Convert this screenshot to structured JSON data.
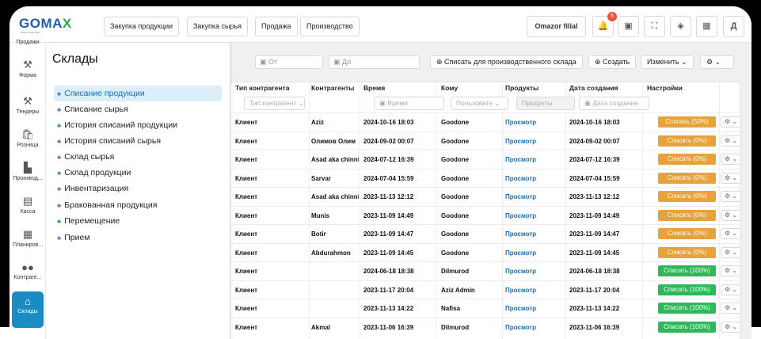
{
  "logo": {
    "text_main": "GOMA",
    "text_x": "X",
    "tagline": "make in high place"
  },
  "nav": [
    "Закупка продукции",
    "Закупка сырья",
    "Продажа",
    "Производство"
  ],
  "filial": "Omazor filial",
  "notifications": {
    "count": "5"
  },
  "user_initial": "Д",
  "sidebar": [
    {
      "label": "Продажи",
      "icon": "sales-icon"
    },
    {
      "label": "Форма",
      "icon": "hammer-icon"
    },
    {
      "label": "Тендеры",
      "icon": "hammer-icon"
    },
    {
      "label": "Розница",
      "icon": "bag-icon"
    },
    {
      "label": "Производ...",
      "icon": "factory-icon"
    },
    {
      "label": "Касса",
      "icon": "cashbox-icon"
    },
    {
      "label": "Планиров...",
      "icon": "calendar-icon"
    },
    {
      "label": "Контраге...",
      "icon": "people-icon"
    },
    {
      "label": "Склады",
      "icon": "warehouse-icon",
      "active": true
    }
  ],
  "panel": {
    "title": "Склады",
    "items": [
      "Списание продукции",
      "Списание сырья",
      "История списаний продукции",
      "История списаний сырья",
      "Склад сырья",
      "Склад продукции",
      "Инвентаризация",
      "Бракованная продукция",
      "Перемещение",
      "Прием"
    ]
  },
  "filters": {
    "from": "От",
    "to": "До"
  },
  "actions": {
    "write_off": "Списать для производственного склада",
    "create": "Создать",
    "edit": "Изменить"
  },
  "table": {
    "headers": [
      "Тип контрагента",
      "Контрагенты",
      "Время",
      "Кому",
      "Продукты",
      "Дата создания",
      "Настройки"
    ],
    "filter_placeholders": {
      "type": "Тип контрагент",
      "time": "Время",
      "to": "Пользовате",
      "products": "Продукты",
      "created": "Дата создания"
    },
    "rows": [
      {
        "type": "Клиент",
        "partner": "Aziz",
        "time": "2024-10-16 18:03",
        "to": "Goodone",
        "products": "Просмотр",
        "created": "2024-10-16 18:03",
        "status": "Списать (50%)",
        "color": "#e7a23b"
      },
      {
        "type": "Клиент",
        "partner": "Олимов Олим",
        "time": "2024-09-02 00:07",
        "to": "Goodone",
        "products": "Просмотр",
        "created": "2024-09-02 00:07",
        "status": "Списать (0%)",
        "color": "#e7a23b"
      },
      {
        "type": "Клиент",
        "partner": "Asad aka chinni",
        "time": "2024-07-12 16:39",
        "to": "Goodone",
        "products": "Просмотр",
        "created": "2024-07-12 16:39",
        "status": "Списать (0%)",
        "color": "#e7a23b"
      },
      {
        "type": "Клиент",
        "partner": "Sarvar",
        "time": "2024-07-04 15:59",
        "to": "Goodone",
        "products": "Просмотр",
        "created": "2024-07-04 15:59",
        "status": "Списать (0%)",
        "color": "#e7a23b"
      },
      {
        "type": "Клиент",
        "partner": "Asad aka chinni",
        "time": "2023-11-13 12:12",
        "to": "Goodone",
        "products": "Просмотр",
        "created": "2023-11-13 12:12",
        "status": "Списать (0%)",
        "color": "#e7a23b"
      },
      {
        "type": "Клиент",
        "partner": "Munis",
        "time": "2023-11-09 14:49",
        "to": "Goodone",
        "products": "Просмотр",
        "created": "2023-11-09 14:49",
        "status": "Списать (0%)",
        "color": "#e7a23b"
      },
      {
        "type": "Клиент",
        "partner": "Botir",
        "time": "2023-11-09 14:47",
        "to": "Goodone",
        "products": "Просмотр",
        "created": "2023-11-09 14:47",
        "status": "Списать (0%)",
        "color": "#e7a23b"
      },
      {
        "type": "Клиент",
        "partner": "Abdurahmon",
        "time": "2023-11-09 14:45",
        "to": "Goodone",
        "products": "Просмотр",
        "created": "2023-11-09 14:45",
        "status": "Списать (0%)",
        "color": "#e7a23b"
      },
      {
        "type": "Клиент",
        "partner": "",
        "time": "2024-06-18 18:38",
        "to": "Dilmurod",
        "products": "Просмотр",
        "created": "2024-06-18 18:38",
        "status": "Списать (100%)",
        "color": "#2fb85a"
      },
      {
        "type": "Клиент",
        "partner": "",
        "time": "2023-11-17 20:04",
        "to": "Aziz Admin",
        "products": "Просмотр",
        "created": "2023-11-17 20:04",
        "status": "Списать (100%)",
        "color": "#2fb85a"
      },
      {
        "type": "Клиент",
        "partner": "",
        "time": "2023-11-13 14:22",
        "to": "Nafisa",
        "products": "Просмотр",
        "created": "2023-11-13 14:22",
        "status": "Списать (100%)",
        "color": "#2fb85a"
      },
      {
        "type": "Клиент",
        "partner": "Akmal",
        "time": "2023-11-06 16:39",
        "to": "Dilmurod",
        "products": "Просмотр",
        "created": "2023-11-06 16:39",
        "status": "Списать (100%)",
        "color": "#2fb85a"
      }
    ]
  }
}
